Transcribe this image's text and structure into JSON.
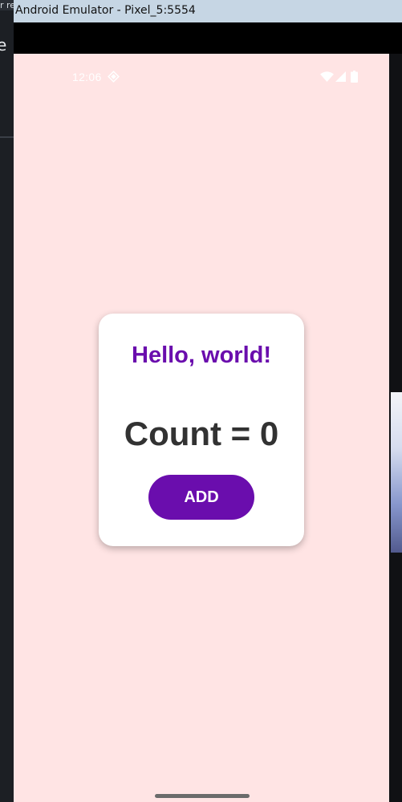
{
  "window": {
    "title": "Android Emulator - Pixel_5:5554"
  },
  "background_window": {
    "partial_title": "r repo",
    "partial_glyph": "e"
  },
  "status_bar": {
    "time": "12:06",
    "icons": [
      "sync-icon",
      "wifi-icon",
      "signal-icon",
      "battery-icon"
    ]
  },
  "app": {
    "greeting": "Hello, world!",
    "count_text": "Count = 0",
    "add_button_label": "ADD"
  },
  "colors": {
    "screen_background": "#ffe4e4",
    "card_background": "#ffffff",
    "accent": "#6a0dad",
    "count_text": "#323232"
  }
}
